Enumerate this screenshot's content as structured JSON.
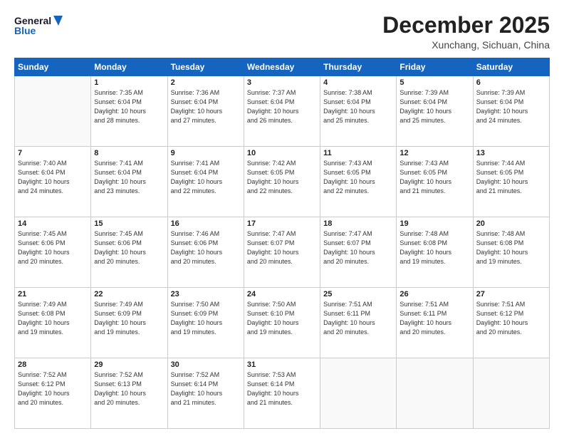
{
  "header": {
    "logo_line1": "General",
    "logo_line2": "Blue",
    "month": "December 2025",
    "location": "Xunchang, Sichuan, China"
  },
  "weekdays": [
    "Sunday",
    "Monday",
    "Tuesday",
    "Wednesday",
    "Thursday",
    "Friday",
    "Saturday"
  ],
  "weeks": [
    [
      {
        "day": "",
        "info": ""
      },
      {
        "day": "1",
        "info": "Sunrise: 7:35 AM\nSunset: 6:04 PM\nDaylight: 10 hours\nand 28 minutes."
      },
      {
        "day": "2",
        "info": "Sunrise: 7:36 AM\nSunset: 6:04 PM\nDaylight: 10 hours\nand 27 minutes."
      },
      {
        "day": "3",
        "info": "Sunrise: 7:37 AM\nSunset: 6:04 PM\nDaylight: 10 hours\nand 26 minutes."
      },
      {
        "day": "4",
        "info": "Sunrise: 7:38 AM\nSunset: 6:04 PM\nDaylight: 10 hours\nand 25 minutes."
      },
      {
        "day": "5",
        "info": "Sunrise: 7:39 AM\nSunset: 6:04 PM\nDaylight: 10 hours\nand 25 minutes."
      },
      {
        "day": "6",
        "info": "Sunrise: 7:39 AM\nSunset: 6:04 PM\nDaylight: 10 hours\nand 24 minutes."
      }
    ],
    [
      {
        "day": "7",
        "info": "Sunrise: 7:40 AM\nSunset: 6:04 PM\nDaylight: 10 hours\nand 24 minutes."
      },
      {
        "day": "8",
        "info": "Sunrise: 7:41 AM\nSunset: 6:04 PM\nDaylight: 10 hours\nand 23 minutes."
      },
      {
        "day": "9",
        "info": "Sunrise: 7:41 AM\nSunset: 6:04 PM\nDaylight: 10 hours\nand 22 minutes."
      },
      {
        "day": "10",
        "info": "Sunrise: 7:42 AM\nSunset: 6:05 PM\nDaylight: 10 hours\nand 22 minutes."
      },
      {
        "day": "11",
        "info": "Sunrise: 7:43 AM\nSunset: 6:05 PM\nDaylight: 10 hours\nand 22 minutes."
      },
      {
        "day": "12",
        "info": "Sunrise: 7:43 AM\nSunset: 6:05 PM\nDaylight: 10 hours\nand 21 minutes."
      },
      {
        "day": "13",
        "info": "Sunrise: 7:44 AM\nSunset: 6:05 PM\nDaylight: 10 hours\nand 21 minutes."
      }
    ],
    [
      {
        "day": "14",
        "info": "Sunrise: 7:45 AM\nSunset: 6:06 PM\nDaylight: 10 hours\nand 20 minutes."
      },
      {
        "day": "15",
        "info": "Sunrise: 7:45 AM\nSunset: 6:06 PM\nDaylight: 10 hours\nand 20 minutes."
      },
      {
        "day": "16",
        "info": "Sunrise: 7:46 AM\nSunset: 6:06 PM\nDaylight: 10 hours\nand 20 minutes."
      },
      {
        "day": "17",
        "info": "Sunrise: 7:47 AM\nSunset: 6:07 PM\nDaylight: 10 hours\nand 20 minutes."
      },
      {
        "day": "18",
        "info": "Sunrise: 7:47 AM\nSunset: 6:07 PM\nDaylight: 10 hours\nand 20 minutes."
      },
      {
        "day": "19",
        "info": "Sunrise: 7:48 AM\nSunset: 6:08 PM\nDaylight: 10 hours\nand 19 minutes."
      },
      {
        "day": "20",
        "info": "Sunrise: 7:48 AM\nSunset: 6:08 PM\nDaylight: 10 hours\nand 19 minutes."
      }
    ],
    [
      {
        "day": "21",
        "info": "Sunrise: 7:49 AM\nSunset: 6:08 PM\nDaylight: 10 hours\nand 19 minutes."
      },
      {
        "day": "22",
        "info": "Sunrise: 7:49 AM\nSunset: 6:09 PM\nDaylight: 10 hours\nand 19 minutes."
      },
      {
        "day": "23",
        "info": "Sunrise: 7:50 AM\nSunset: 6:09 PM\nDaylight: 10 hours\nand 19 minutes."
      },
      {
        "day": "24",
        "info": "Sunrise: 7:50 AM\nSunset: 6:10 PM\nDaylight: 10 hours\nand 19 minutes."
      },
      {
        "day": "25",
        "info": "Sunrise: 7:51 AM\nSunset: 6:11 PM\nDaylight: 10 hours\nand 20 minutes."
      },
      {
        "day": "26",
        "info": "Sunrise: 7:51 AM\nSunset: 6:11 PM\nDaylight: 10 hours\nand 20 minutes."
      },
      {
        "day": "27",
        "info": "Sunrise: 7:51 AM\nSunset: 6:12 PM\nDaylight: 10 hours\nand 20 minutes."
      }
    ],
    [
      {
        "day": "28",
        "info": "Sunrise: 7:52 AM\nSunset: 6:12 PM\nDaylight: 10 hours\nand 20 minutes."
      },
      {
        "day": "29",
        "info": "Sunrise: 7:52 AM\nSunset: 6:13 PM\nDaylight: 10 hours\nand 20 minutes."
      },
      {
        "day": "30",
        "info": "Sunrise: 7:52 AM\nSunset: 6:14 PM\nDaylight: 10 hours\nand 21 minutes."
      },
      {
        "day": "31",
        "info": "Sunrise: 7:53 AM\nSunset: 6:14 PM\nDaylight: 10 hours\nand 21 minutes."
      },
      {
        "day": "",
        "info": ""
      },
      {
        "day": "",
        "info": ""
      },
      {
        "day": "",
        "info": ""
      }
    ]
  ]
}
